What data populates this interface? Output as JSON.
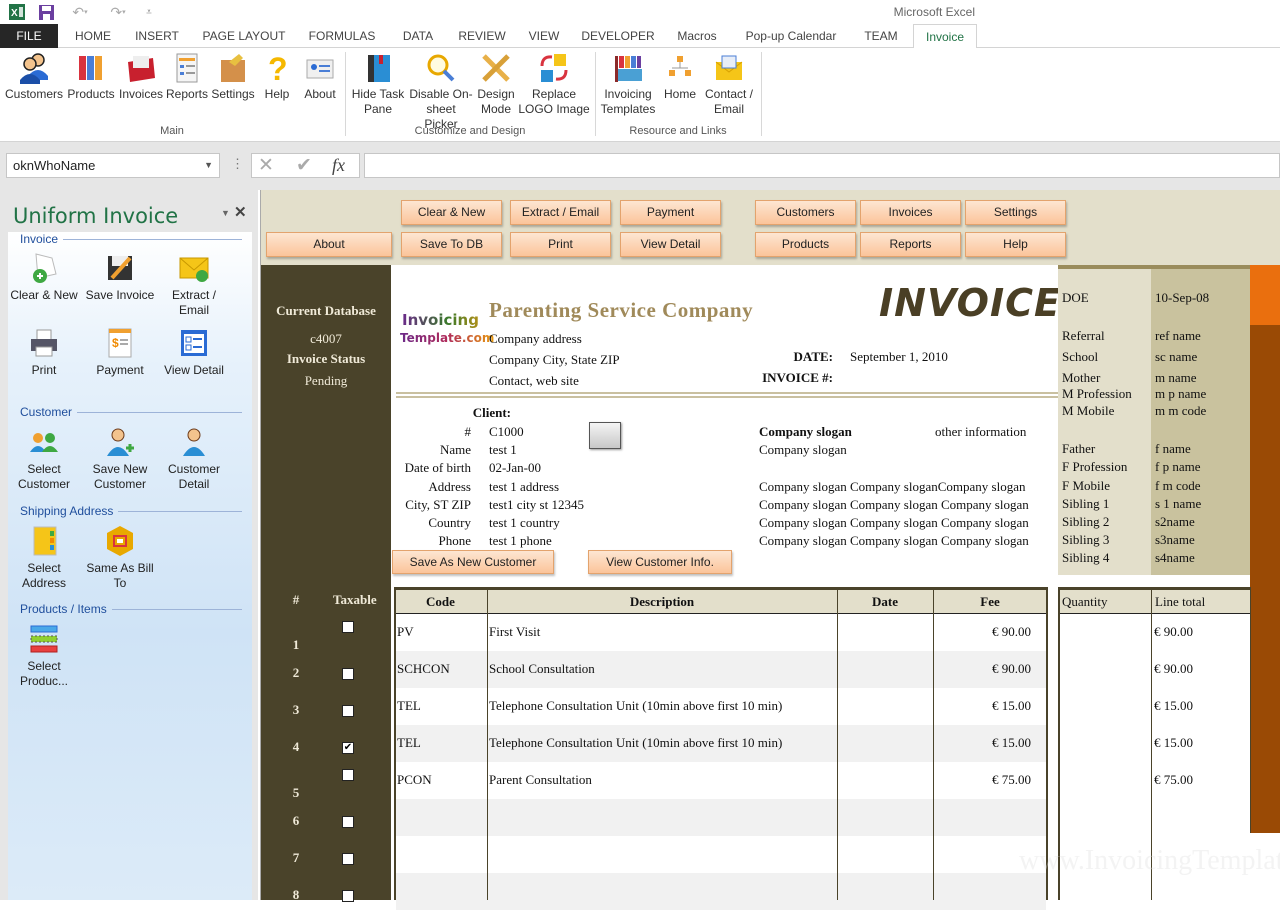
{
  "app": {
    "title": "Microsoft Excel"
  },
  "quick_access": {
    "excel_icon": "excel-logo-icon",
    "save_icon": "save-icon",
    "undo_icon": "undo-icon",
    "redo_icon": "redo-icon",
    "customize_icon": "customize-qat-icon"
  },
  "tabs": [
    {
      "label": "FILE"
    },
    {
      "label": "HOME"
    },
    {
      "label": "INSERT"
    },
    {
      "label": "PAGE LAYOUT"
    },
    {
      "label": "FORMULAS"
    },
    {
      "label": "DATA"
    },
    {
      "label": "REVIEW"
    },
    {
      "label": "VIEW"
    },
    {
      "label": "DEVELOPER"
    },
    {
      "label": "Macros"
    },
    {
      "label": "Pop-up Calendar"
    },
    {
      "label": "TEAM"
    },
    {
      "label": "Invoice"
    }
  ],
  "active_tab": "Invoice",
  "ribbon": {
    "groups": [
      {
        "label": "Main",
        "buttons": [
          {
            "label": "Customers",
            "icon": "customers-icon"
          },
          {
            "label": "Products",
            "icon": "products-icon"
          },
          {
            "label": "Invoices",
            "icon": "invoices-icon"
          },
          {
            "label": "Reports",
            "icon": "reports-icon"
          },
          {
            "label": "Settings",
            "icon": "settings-icon"
          },
          {
            "label": "Help",
            "icon": "help-icon"
          },
          {
            "label": "About",
            "icon": "about-icon"
          }
        ]
      },
      {
        "label": "Customize and Design",
        "buttons": [
          {
            "label": "Hide Task",
            "label2": "Pane",
            "icon": "hide-task-pane-icon"
          },
          {
            "label": "Disable On-",
            "label2": "sheet Picker",
            "icon": "magnifier-icon"
          },
          {
            "label": "Design",
            "label2": "Mode",
            "icon": "design-mode-icon"
          },
          {
            "label": "Replace",
            "label2": "LOGO Image",
            "icon": "replace-logo-icon"
          }
        ]
      },
      {
        "label": "Resource and Links",
        "buttons": [
          {
            "label": "Invoicing",
            "label2": "Templates",
            "icon": "templates-icon"
          },
          {
            "label": "Home",
            "icon": "home-sitemap-icon"
          },
          {
            "label": "Contact /",
            "label2": "Email",
            "icon": "email-icon"
          }
        ]
      }
    ]
  },
  "formula_bar": {
    "name_box": "oknWhoName",
    "cancel_icon": "cancel-icon",
    "enter_icon": "enter-icon",
    "fx_label": "fx",
    "formula": ""
  },
  "task_pane": {
    "title": "Uniform Invoice",
    "sections": [
      {
        "label": "Invoice",
        "items": [
          {
            "label": "Clear & New",
            "icon": "clear-new-icon"
          },
          {
            "label": "Save Invoice",
            "icon": "save-invoice-icon"
          },
          {
            "label": "Extract /",
            "label2": "Email",
            "icon": "extract-email-icon"
          },
          {
            "label": "Print",
            "icon": "print-icon"
          },
          {
            "label": "Payment",
            "icon": "payment-icon"
          },
          {
            "label": "View Detail",
            "icon": "view-detail-icon"
          }
        ]
      },
      {
        "label": "Customer",
        "items": [
          {
            "label": "Select",
            "label2": "Customer",
            "icon": "select-customer-icon"
          },
          {
            "label": "Save New",
            "label2": "Customer",
            "icon": "save-new-customer-icon"
          },
          {
            "label": "Customer",
            "label2": "Detail",
            "icon": "customer-detail-icon"
          }
        ]
      },
      {
        "label": "Shipping Address",
        "items": [
          {
            "label": "Select",
            "label2": "Address",
            "icon": "select-address-icon"
          },
          {
            "label": "Same As Bill",
            "label2": "To",
            "icon": "same-as-bill-icon"
          }
        ]
      },
      {
        "label": "Products / Items",
        "items": [
          {
            "label": "Select",
            "label2": "Produc...",
            "icon": "select-products-icon"
          }
        ]
      }
    ]
  },
  "sheet_buttons": {
    "about": "About",
    "clear_new": "Clear & New",
    "save_db": "Save To DB",
    "extract_email": "Extract / Email",
    "print": "Print",
    "payment": "Payment",
    "view_detail": "View Detail",
    "customers": "Customers",
    "products": "Products",
    "invoices": "Invoices",
    "reports": "Reports",
    "settings": "Settings",
    "help": "Help",
    "save_new_customer": "Save As New Customer",
    "view_customer_info": "View Customer Info."
  },
  "left_column": {
    "db_label": "Current Database",
    "db_value": "c4007",
    "status_label": "Invoice Status",
    "status_value": "Pending"
  },
  "invoice": {
    "logo_line1": "Invoicing",
    "logo_line2": "Template.com",
    "company_name": "Parenting Service Company",
    "title": "INVOICE",
    "company_address": "Company address",
    "company_city": "Company City, State ZIP",
    "company_contact": "Contact, web site",
    "date_label": "DATE:",
    "date_value": "September 1, 2010",
    "invoice_no_label": "INVOICE #:",
    "invoice_no_value": ""
  },
  "client": {
    "heading": "Client:",
    "fields": [
      {
        "label": "#",
        "value": "C1000"
      },
      {
        "label": "Name",
        "value": "test 1"
      },
      {
        "label": "Date of birth",
        "value": "02-Jan-00"
      },
      {
        "label": "Address",
        "value": "test 1 address"
      },
      {
        "label": "City, ST ZIP",
        "value": "test1 city st 12345"
      },
      {
        "label": "Country",
        "value": "test 1 country"
      },
      {
        "label": "Phone",
        "value": "test 1 phone"
      }
    ]
  },
  "slogan": {
    "heading": "Company slogan",
    "other": "other information",
    "line1": "Company slogan",
    "lines": [
      "Company slogan Company sloganCompany slogan",
      "Company slogan Company slogan Company slogan",
      "Company slogan Company slogan Company slogan",
      "Company slogan Company slogan Company slogan"
    ]
  },
  "extra_info": [
    {
      "label": "DOE",
      "value": "10-Sep-08"
    },
    {
      "label": "Referral",
      "value": "ref name"
    },
    {
      "label": "School",
      "value": "sc name"
    },
    {
      "label": "Mother",
      "value": "m name"
    },
    {
      "label": "M Profession",
      "value": "m p name"
    },
    {
      "label": "M Mobile",
      "value": "m m code"
    },
    {
      "label": "Father",
      "value": "f name"
    },
    {
      "label": "F Profession",
      "value": "f p name"
    },
    {
      "label": "F Mobile",
      "value": "f m code"
    },
    {
      "label": "Sibling 1",
      "value": "s 1 name"
    },
    {
      "label": "Sibling 2",
      "value": "s2name"
    },
    {
      "label": "Sibling 3",
      "value": "s3name"
    },
    {
      "label": "Sibling 4",
      "value": "s4name"
    }
  ],
  "table": {
    "headers": {
      "num": "#",
      "taxable": "Taxable",
      "code": "Code",
      "description": "Description",
      "date": "Date",
      "fee": "Fee",
      "quantity": "Quantity",
      "line_total": "Line total"
    },
    "rows": [
      {
        "num": "1",
        "taxable": false,
        "code": "PV",
        "description": "First Visit",
        "date": "",
        "fee": "€ 90.00",
        "quantity": "",
        "line_total": "€ 90.00"
      },
      {
        "num": "2",
        "taxable": false,
        "code": "SCHCON",
        "description": "School Consultation",
        "date": "",
        "fee": "€ 90.00",
        "quantity": "",
        "line_total": "€ 90.00"
      },
      {
        "num": "3",
        "taxable": false,
        "code": "TEL",
        "description": "Telephone Consultation Unit (10min above first 10 min)",
        "date": "",
        "fee": "€ 15.00",
        "quantity": "",
        "line_total": "€ 15.00"
      },
      {
        "num": "4",
        "taxable": true,
        "code": "TEL",
        "description": "Telephone Consultation Unit (10min above first 10 min)",
        "date": "",
        "fee": "€ 15.00",
        "quantity": "",
        "line_total": "€ 15.00"
      },
      {
        "num": "5",
        "taxable": false,
        "code": "PCON",
        "description": "Parent Consultation",
        "date": "",
        "fee": "€ 75.00",
        "quantity": "",
        "line_total": "€ 75.00"
      },
      {
        "num": "6",
        "taxable": false,
        "code": "",
        "description": "",
        "date": "",
        "fee": "",
        "quantity": "",
        "line_total": ""
      },
      {
        "num": "7",
        "taxable": false,
        "code": "",
        "description": "",
        "date": "",
        "fee": "",
        "quantity": "",
        "line_total": ""
      },
      {
        "num": "8",
        "taxable": false,
        "code": "",
        "description": "",
        "date": "",
        "fee": "",
        "quantity": "",
        "line_total": ""
      }
    ]
  },
  "watermark": "www.InvoicingTemplate.com",
  "colors": {
    "accent_green": "#217346",
    "sheet_dark": "#4a432a",
    "button_orange": "#fbc49a",
    "header_beige": "#e3dfcb",
    "orange_strip": "#ea6f0e",
    "brown_strip": "#9a4a05"
  }
}
